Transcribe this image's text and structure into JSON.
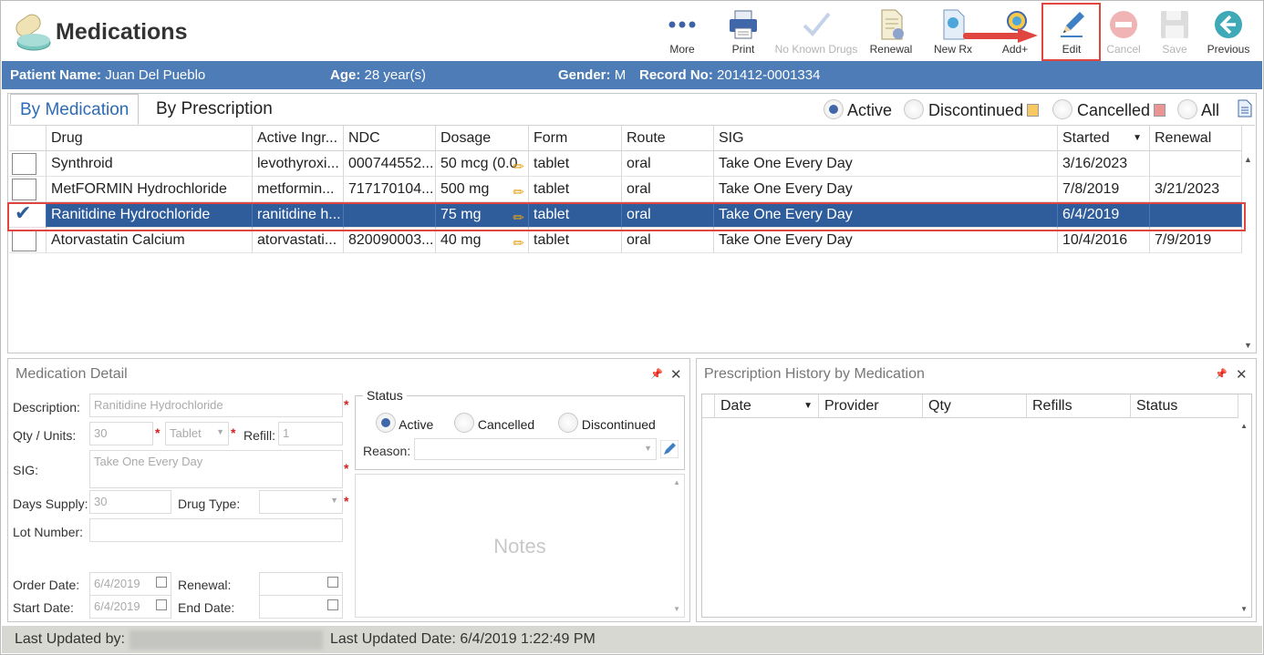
{
  "app": {
    "title": "Medications"
  },
  "toolbar": [
    {
      "id": "more",
      "label": "More",
      "icon": "more-dots-icon",
      "enabled": true
    },
    {
      "id": "print",
      "label": "Print",
      "icon": "printer-icon",
      "enabled": true
    },
    {
      "id": "no_known_drugs",
      "label": "No Known Drugs",
      "icon": "checkmark-icon",
      "enabled": false
    },
    {
      "id": "renewal",
      "label": "Renewal",
      "icon": "document-icon",
      "enabled": true
    },
    {
      "id": "new_rx",
      "label": "New Rx",
      "icon": "new-rx-icon",
      "enabled": true
    },
    {
      "id": "add_plus",
      "label": "Add+",
      "icon": "add-plus-icon",
      "enabled": true
    },
    {
      "id": "edit",
      "label": "Edit",
      "icon": "pencil-icon",
      "enabled": true
    },
    {
      "id": "cancel",
      "label": "Cancel",
      "icon": "cancel-icon",
      "enabled": false
    },
    {
      "id": "save",
      "label": "Save",
      "icon": "save-icon",
      "enabled": false
    },
    {
      "id": "previous",
      "label": "Previous",
      "icon": "back-arrow-icon",
      "enabled": true
    }
  ],
  "patient": {
    "name_label": "Patient Name:",
    "name": "Juan Del Pueblo",
    "age_label": "Age:",
    "age": "28 year(s)",
    "gender_label": "Gender:",
    "gender": "M",
    "record_label": "Record No:",
    "record": "201412-0001334"
  },
  "tabs": {
    "by_medication": "By Medication",
    "by_prescription": "By Prescription"
  },
  "filters": {
    "active": "Active",
    "discontinued": "Discontinued",
    "cancelled": "Cancelled",
    "all": "All",
    "selected": "Active",
    "discontinued_color": "#f6c862",
    "cancelled_color": "#e99595"
  },
  "columns": [
    "Drug",
    "Active Ingr...",
    "NDC",
    "Dosage",
    "Form",
    "Route",
    "SIG",
    "Started",
    "Renewal"
  ],
  "rows": [
    {
      "checked": false,
      "drug": "Synthroid",
      "ingr": "levothyroxi...",
      "ndc": "000744552...",
      "dosage": "50 mcg (0.0",
      "form": "tablet",
      "route": "oral",
      "sig": "Take One Every Day",
      "started": "3/16/2023",
      "renewal": ""
    },
    {
      "checked": false,
      "drug": "MetFORMIN Hydrochloride",
      "ingr": "metformin...",
      "ndc": "717170104...",
      "dosage": "500 mg",
      "form": "tablet",
      "route": "oral",
      "sig": "Take One Every Day",
      "started": "7/8/2019",
      "renewal": "3/21/2023"
    },
    {
      "checked": true,
      "drug": "Ranitidine Hydrochloride",
      "ingr": "ranitidine h...",
      "ndc": "",
      "dosage": "75 mg",
      "form": "tablet",
      "route": "oral",
      "sig": "Take One Every Day",
      "started": "6/4/2019",
      "renewal": ""
    },
    {
      "checked": false,
      "drug": "Atorvastatin Calcium",
      "ingr": "atorvastati...",
      "ndc": "820090003...",
      "dosage": "40 mg",
      "form": "tablet",
      "route": "oral",
      "sig": "Take One Every Day",
      "started": "10/4/2016",
      "renewal": "7/9/2019"
    }
  ],
  "detail": {
    "title": "Medication Detail",
    "description_label": "Description:",
    "description": "Ranitidine Hydrochloride",
    "qty_label": "Qty / Units:",
    "qty": "30",
    "units": "Tablet",
    "refill_label": "Refill:",
    "refill": "1",
    "sig_label": "SIG:",
    "sig": "Take One Every Day",
    "days_supply_label": "Days Supply:",
    "days_supply": "30",
    "drug_type_label": "Drug Type:",
    "drug_type": "",
    "lot_label": "Lot Number:",
    "lot": "",
    "order_date_label": "Order Date:",
    "order_date": "6/4/2019",
    "renewal_label": "Renewal:",
    "renewal": "",
    "start_date_label": "Start Date:",
    "start_date": "6/4/2019",
    "end_date_label": "End Date:",
    "end_date": "",
    "status_legend": "Status",
    "status_active": "Active",
    "status_cancelled": "Cancelled",
    "status_discontinued": "Discontinued",
    "status_selected": "Active",
    "reason_label": "Reason:",
    "reason": "",
    "notes_placeholder": "Notes"
  },
  "history": {
    "title": "Prescription History by Medication",
    "columns": [
      "Date",
      "Provider",
      "Qty",
      "Refills",
      "Status"
    ]
  },
  "footer": {
    "last_updated_by_label": "Last Updated by:",
    "last_updated_date_label": "Last Updated Date:",
    "last_updated_date": "6/4/2019 1:22:49 PM"
  }
}
